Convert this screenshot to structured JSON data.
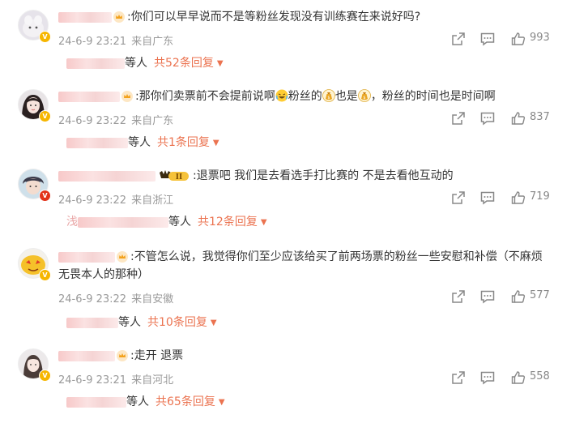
{
  "comments": [
    {
      "text": ":你们可以早早说而不是等粉丝发现没有训练赛在来说好吗?",
      "date": "24-6-9 23:21",
      "location": "来自广东",
      "likes": "993",
      "replies_prefix": "等人",
      "replies_total": "共52条回复",
      "badge": "V"
    },
    {
      "text_parts": [
        ":那你们卖票前不会提前说啊",
        "粉丝的",
        "也是",
        "，粉丝的时间也是时间啊"
      ],
      "date": "24-6-9 23:22",
      "location": "来自广东",
      "likes": "837",
      "replies_prefix": "等人",
      "replies_total": "共1条回复",
      "badge": "V"
    },
    {
      "text": ":退票吧 我们是去看选手打比赛的 不是去看他互动的",
      "level_badge": "II",
      "date": "24-6-9 23:22",
      "location": "来自浙江",
      "likes": "719",
      "replies_lead": "浅",
      "replies_prefix": "等人",
      "replies_total": "共12条回复",
      "badge": "V"
    },
    {
      "text_line1": ":不管怎么说，我觉得你们至少应该给买了前两场票的粉丝一些安慰和补偿（不麻烦",
      "text_line2": "无畏本人的那种）",
      "date": "24-6-9 23:22",
      "location": "来自安徽",
      "likes": "577",
      "replies_prefix": "等人",
      "replies_total": "共10条回复",
      "badge": "V"
    },
    {
      "text": ":走开 退票",
      "date": "24-6-9 23:21",
      "location": "来自河北",
      "likes": "558",
      "replies_prefix": "等人",
      "replies_total": "共65条回复",
      "badge": "V"
    }
  ],
  "icons": {
    "share": "share-icon",
    "comment": "comment-icon",
    "like": "thumbs-up-icon",
    "dropdown": "chevron-down-icon"
  },
  "colors": {
    "accent": "#eb7350",
    "meta": "#999999",
    "text": "#333333"
  }
}
